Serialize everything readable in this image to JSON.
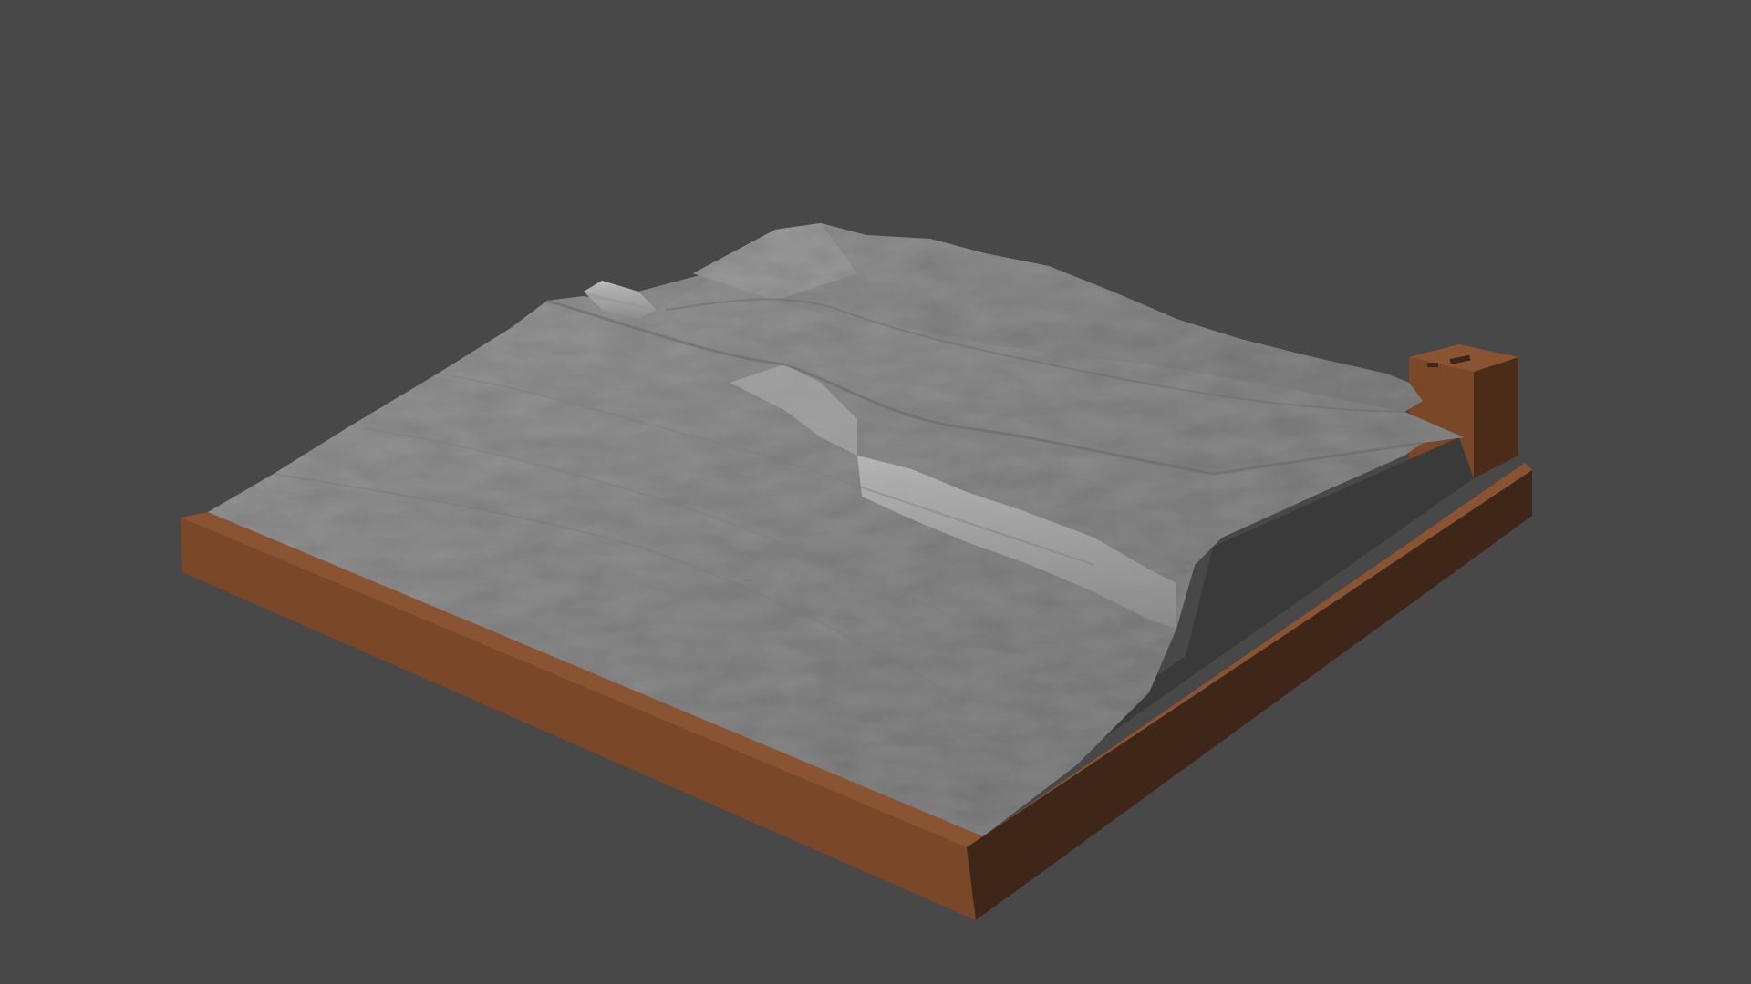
{
  "viewport": {
    "background_color": "#484848"
  },
  "model": {
    "terrain_color": "#8c8c8c",
    "terrain_highlight_color": "#b4b4b4",
    "terrain_shadow_color": "#5e5e5e",
    "base_frame_color": "#7a4828",
    "base_frame_dark_color": "#3e2618",
    "side_wall_color": "#3c3c3c"
  }
}
